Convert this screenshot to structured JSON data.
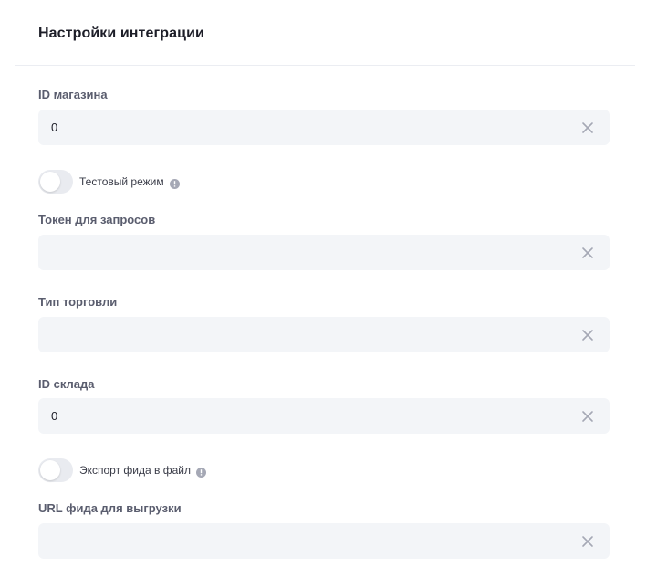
{
  "header": {
    "title": "Настройки интеграции"
  },
  "form": {
    "shop_id": {
      "label": "ID магазина",
      "value": "0"
    },
    "test_mode": {
      "label": "Тестовый режим",
      "enabled": false
    },
    "token": {
      "label": "Токен для запросов",
      "value": ""
    },
    "trade_type": {
      "label": "Тип торговли",
      "value": ""
    },
    "warehouse_id": {
      "label": "ID склада",
      "value": "0"
    },
    "feed_export": {
      "label": "Экспорт фида в файл",
      "enabled": false
    },
    "feed_url": {
      "label": "URL фида для выгрузки",
      "value": ""
    }
  },
  "icons": {
    "clear": "close-icon",
    "info": "info-icon"
  },
  "colors": {
    "field_bg": "#f3f5f8",
    "label": "#5a5d6e",
    "title": "#1d1e28",
    "icon": "#a5a8b5"
  }
}
